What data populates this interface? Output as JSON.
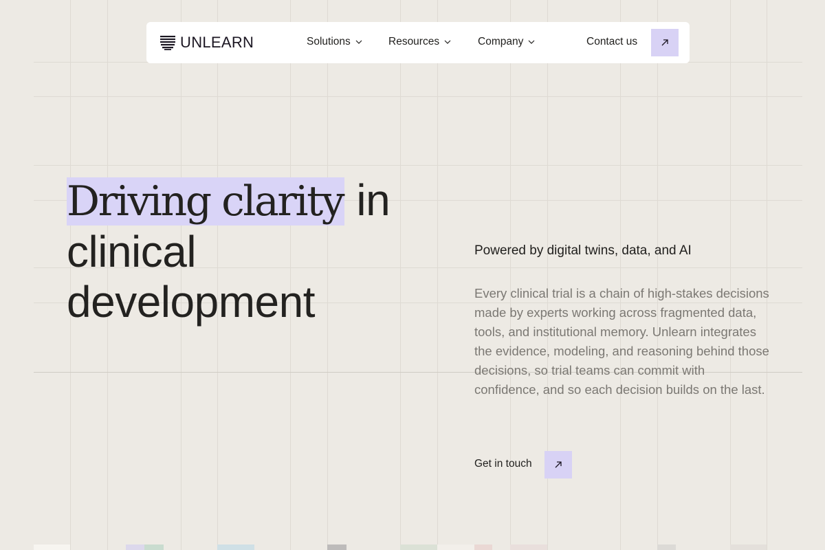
{
  "brand": {
    "name": "UNLEARN"
  },
  "nav": {
    "items": [
      {
        "label": "Solutions"
      },
      {
        "label": "Resources"
      },
      {
        "label": "Company"
      }
    ],
    "contact_label": "Contact us",
    "contact_icon": "arrow-up-right-icon"
  },
  "hero": {
    "headline_highlight": "Driving clarity",
    "headline_rest_1": " in",
    "headline_line_2": "clinical",
    "headline_line_3": "development",
    "subhead": "Powered by digital twins, data, and AI",
    "body": "Every clinical trial is a chain of high-stakes decisions made by experts working across fragmented data, tools, and institutional memory. Unlearn integrates the evidence, modeling, and reasoning behind those decisions, so trial teams can commit with confidence, and so each decision builds on the last.",
    "cta_label": "Get in touch",
    "cta_icon": "arrow-up-right-icon"
  },
  "colors": {
    "background": "#edeae4",
    "accent": "#d8d2f5",
    "highlight": "#d9d4f7",
    "text": "#1f1e1c",
    "muted_text": "#7b7873"
  }
}
